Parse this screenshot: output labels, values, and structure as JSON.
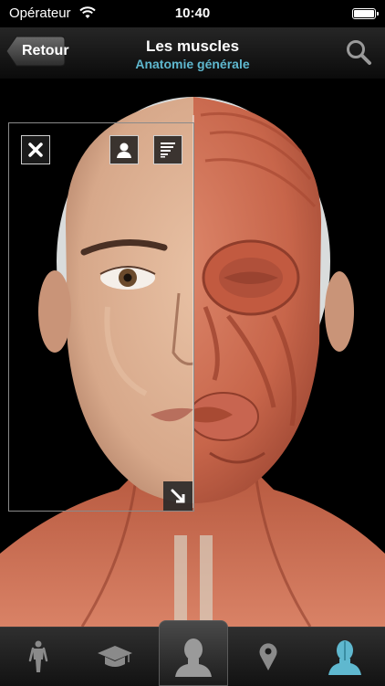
{
  "status_bar": {
    "carrier": "Opérateur",
    "time": "10:40",
    "icons": [
      "wifi-icon",
      "battery-icon"
    ]
  },
  "nav_bar": {
    "back_label": "Retour",
    "title": "Les muscles",
    "subtitle": "Anatomie générale",
    "search_icon": "search-icon"
  },
  "viewer": {
    "illustration": "face-muscles-half-skin-anatomy",
    "panel_buttons": [
      "close-icon",
      "person-icon",
      "layers-icon",
      "resize-diagonal-icon"
    ]
  },
  "tab_bar": {
    "tabs": [
      {
        "icon": "body-figure-icon",
        "selected": false
      },
      {
        "icon": "graduation-cap-icon",
        "selected": false
      },
      {
        "icon": "head-bust-icon",
        "selected": true
      },
      {
        "icon": "map-pin-icon",
        "selected": false
      },
      {
        "icon": "head-anatomy-icon",
        "selected": false
      }
    ]
  },
  "colors": {
    "accent": "#5fb8cf",
    "background": "#000000"
  }
}
